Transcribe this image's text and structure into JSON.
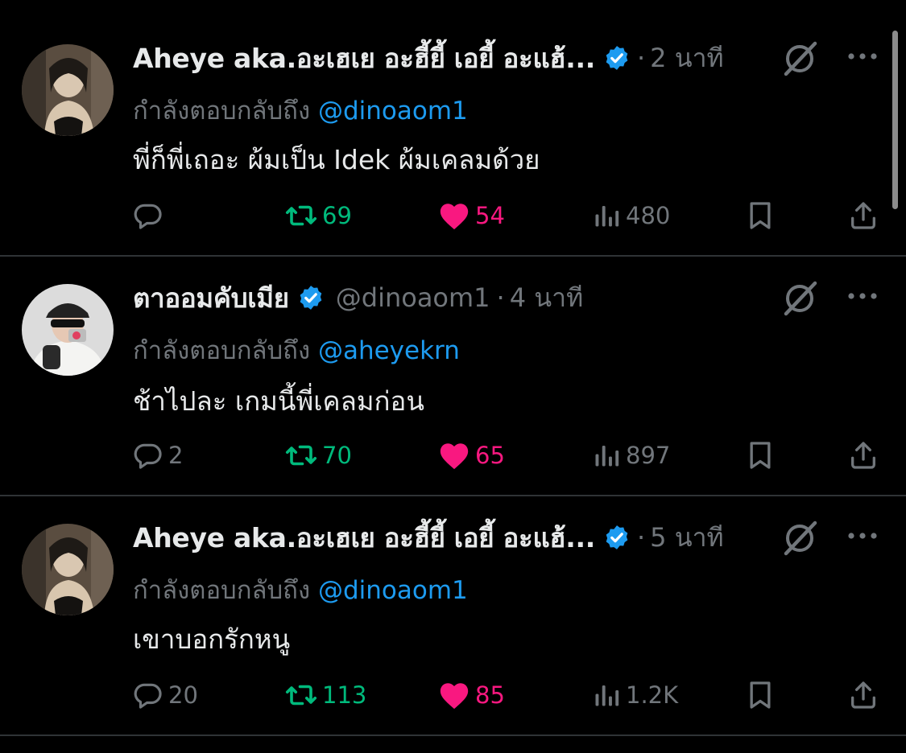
{
  "tweets": [
    {
      "display_name": "Aheye aka.อะเฮเย อะฮี้ยี้ เอยี้ อะแฮ้...",
      "handle": "",
      "dot": "·",
      "time": "2 นาที",
      "reply_prefix": "กำลังตอบกลับถึง ",
      "reply_to": "@dinoaom1",
      "text": "พี่ก็พี่เถอะ ผ้มเป็น Idek ผ้มเคลมด้วย",
      "replies": "",
      "retweets": "69",
      "likes": "54",
      "views": "480",
      "avatar": "woman-sepia-portrait"
    },
    {
      "display_name": "ตาออมคับเมีย",
      "handle": "@dinoaom1",
      "dot": "·",
      "time": "4 นาที",
      "reply_prefix": "กำลังตอบกลับถึง ",
      "reply_to": "@aheyekrn",
      "text": "ช้าไปละ เกมนี้พี่เคลมก่อน",
      "replies": "2",
      "retweets": "70",
      "likes": "65",
      "views": "897",
      "avatar": "person-cap-sunglasses-camera"
    },
    {
      "display_name": "Aheye aka.อะเฮเย อะฮี้ยี้ เอยี้ อะแฮ้...",
      "handle": "",
      "dot": "·",
      "time": "5 นาที",
      "reply_prefix": "กำลังตอบกลับถึง ",
      "reply_to": "@dinoaom1",
      "text": "เขาบอกรักหนู",
      "replies": "20",
      "retweets": "113",
      "likes": "85",
      "views": "1.2K",
      "avatar": "woman-sepia-portrait"
    }
  ],
  "icons": {
    "verified": "verified-badge-icon",
    "grok": "grok-icon",
    "more": "more-icon",
    "reply": "reply-icon",
    "retweet": "retweet-icon",
    "like": "heart-icon",
    "views": "views-icon",
    "bookmark": "bookmark-icon",
    "share": "share-icon"
  },
  "colors": {
    "background": "#000000",
    "text": "#e7e9ea",
    "muted": "#71767b",
    "link": "#1d9bf0",
    "retweet": "#00ba7c",
    "like": "#f91880",
    "divider": "#2f3336"
  }
}
